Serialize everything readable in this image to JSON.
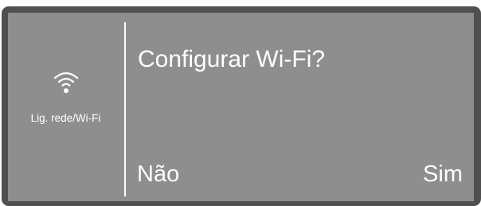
{
  "sidebar": {
    "icon": "wifi-icon",
    "label": "Lig. rede/Wi-Fi"
  },
  "dialog": {
    "prompt": "Configurar Wi-Fi?",
    "no_label": "Não",
    "yes_label": "Sim"
  },
  "colors": {
    "screen_background": "#8e8e8e",
    "bezel": "#505050",
    "text": "#ffffff"
  }
}
